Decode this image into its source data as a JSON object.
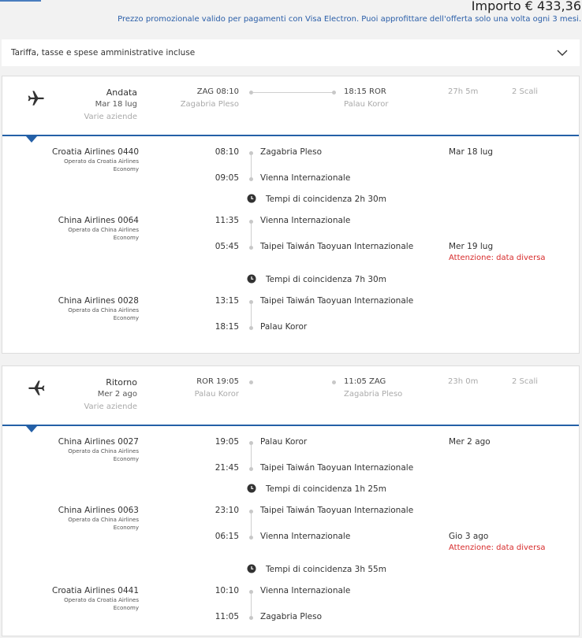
{
  "header": {
    "price": "Importo € 433,36",
    "promo": "Prezzo promozionale valido per pagamenti con Visa Electron. Puoi approfittare dell'offerta solo una volta ogni 3 mesi."
  },
  "fare": {
    "label": "Tariffa, tasse e spese amministrative incluse"
  },
  "outbound": {
    "direction": "Andata",
    "date": "Mar 18 lug",
    "airlines": "Varie aziende",
    "dep": "ZAG 08:10",
    "dep_city": "Zagabria Pleso",
    "arr": "18:15 ROR",
    "arr_city": "Palau Koror",
    "duration": "27h 5m",
    "stops": "2 Scali",
    "segments": [
      {
        "flight": "Croatia Airlines 0440",
        "operated": "Operato da Croatia Airlines",
        "cabin": "Economy",
        "dep_time": "08:10",
        "dep_loc": "Zagabria Pleso",
        "dep_date": "Mar 18 lug",
        "arr_time": "09:05",
        "arr_loc": "Vienna Internazionale"
      },
      {
        "flight": "China Airlines 0064",
        "operated": "Operato da China Airlines",
        "cabin": "Economy",
        "dep_time": "11:35",
        "dep_loc": "Vienna Internazionale",
        "arr_time": "05:45",
        "arr_loc": "Taipei Taiwán Taoyuan Internazionale",
        "arr_date": "Mer 19 lug",
        "arr_warn": "Attenzione: data diversa"
      },
      {
        "flight": "China Airlines 0028",
        "operated": "Operato da China Airlines",
        "cabin": "Economy",
        "dep_time": "13:15",
        "dep_loc": "Taipei Taiwán Taoyuan Internazionale",
        "arr_time": "18:15",
        "arr_loc": "Palau Koror"
      }
    ],
    "connections": [
      "Tempi di coincidenza 2h 30m",
      "Tempi di coincidenza 7h 30m"
    ]
  },
  "return": {
    "direction": "Ritorno",
    "date": "Mer 2 ago",
    "airlines": "Varie aziende",
    "dep": "ROR 19:05",
    "dep_city": "Palau Koror",
    "arr": "11:05 ZAG",
    "arr_city": "Zagabria Pleso",
    "duration": "23h 0m",
    "stops": "2 Scali",
    "segments": [
      {
        "flight": "China Airlines 0027",
        "operated": "Operato da China Airlines",
        "cabin": "Economy",
        "dep_time": "19:05",
        "dep_loc": "Palau Koror",
        "dep_date": "Mer 2 ago",
        "arr_time": "21:45",
        "arr_loc": "Taipei Taiwán Taoyuan Internazionale"
      },
      {
        "flight": "China Airlines 0063",
        "operated": "Operato da China Airlines",
        "cabin": "Economy",
        "dep_time": "23:10",
        "dep_loc": "Taipei Taiwán Taoyuan Internazionale",
        "arr_time": "06:15",
        "arr_loc": "Vienna Internazionale",
        "arr_date": "Gio 3 ago",
        "arr_warn": "Attenzione: data diversa"
      },
      {
        "flight": "Croatia Airlines 0441",
        "operated": "Operato da Croatia Airlines",
        "cabin": "Economy",
        "dep_time": "10:10",
        "dep_loc": "Vienna Internazionale",
        "arr_time": "11:05",
        "arr_loc": "Zagabria Pleso"
      }
    ],
    "connections": [
      "Tempi di coincidenza 1h 25m",
      "Tempi di coincidenza 3h 55m"
    ]
  },
  "icons": {
    "plane": "airplane-icon",
    "clock": "clock-icon",
    "chevron": "chevron-down-icon"
  },
  "colors": {
    "accent": "#2460a7",
    "warning": "#d72c2c",
    "promo": "#2a5ea8"
  }
}
